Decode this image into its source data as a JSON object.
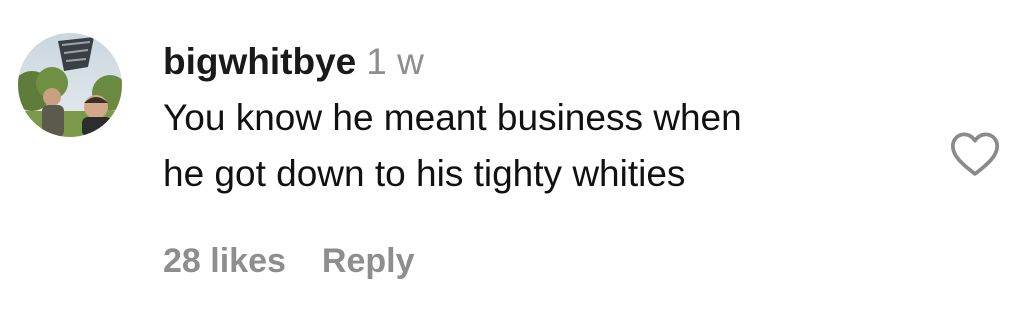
{
  "comment": {
    "username": "bigwhitbye",
    "timestamp": "1 w",
    "text_line1": "You know he meant business when",
    "text_line2": "he got down to his tighty whities",
    "likes": "28 likes",
    "reply_label": "Reply",
    "like_icon": "heart-outline-icon",
    "colors": {
      "text": "#111111",
      "muted": "#8e8e8e",
      "background": "#ffffff"
    }
  }
}
